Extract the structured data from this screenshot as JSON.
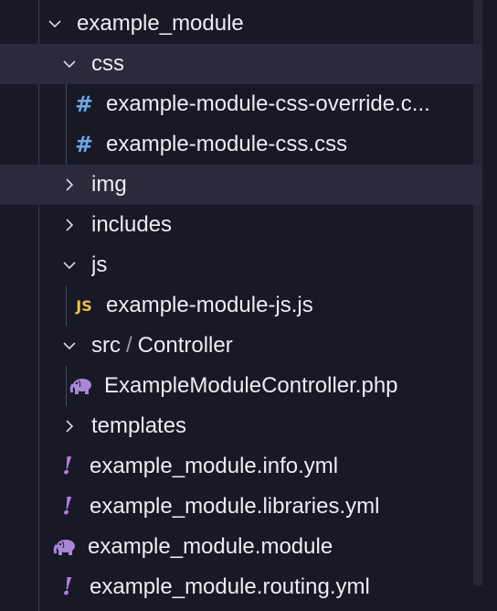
{
  "tree": {
    "root": {
      "label": "example_module",
      "expanded": true
    },
    "css_folder": {
      "label": "css",
      "expanded": true
    },
    "css_files": [
      {
        "label": "example-module-css-override.c...",
        "icon": "hash-icon"
      },
      {
        "label": "example-module-css.css",
        "icon": "hash-icon"
      }
    ],
    "img_folder": {
      "label": "img",
      "expanded": false
    },
    "includes_folder": {
      "label": "includes",
      "expanded": false
    },
    "js_folder": {
      "label": "js",
      "expanded": true
    },
    "js_files": [
      {
        "label": "example-module-js.js",
        "icon_text": "JS"
      }
    ],
    "src_folder": {
      "label": "src",
      "separator": "/",
      "sublabel": "Controller",
      "expanded": true
    },
    "src_files": [
      {
        "label": "ExampleModuleController.php",
        "icon": "php-elephant-icon"
      }
    ],
    "templates_folder": {
      "label": "templates",
      "expanded": false
    },
    "root_files": [
      {
        "label": "example_module.info.yml",
        "icon_text": "!"
      },
      {
        "label": "example_module.libraries.yml",
        "icon_text": "!"
      },
      {
        "label": "example_module.module",
        "icon": "php-elephant-icon"
      },
      {
        "label": "example_module.routing.yml",
        "icon_text": "!"
      }
    ]
  },
  "colors": {
    "background": "#181826",
    "selected_row": "#2a2a3a",
    "css_icon": "#6ea8e6",
    "js_icon": "#e6c44a",
    "yml_icon": "#b07ee6",
    "php_icon": "#a987d6"
  }
}
